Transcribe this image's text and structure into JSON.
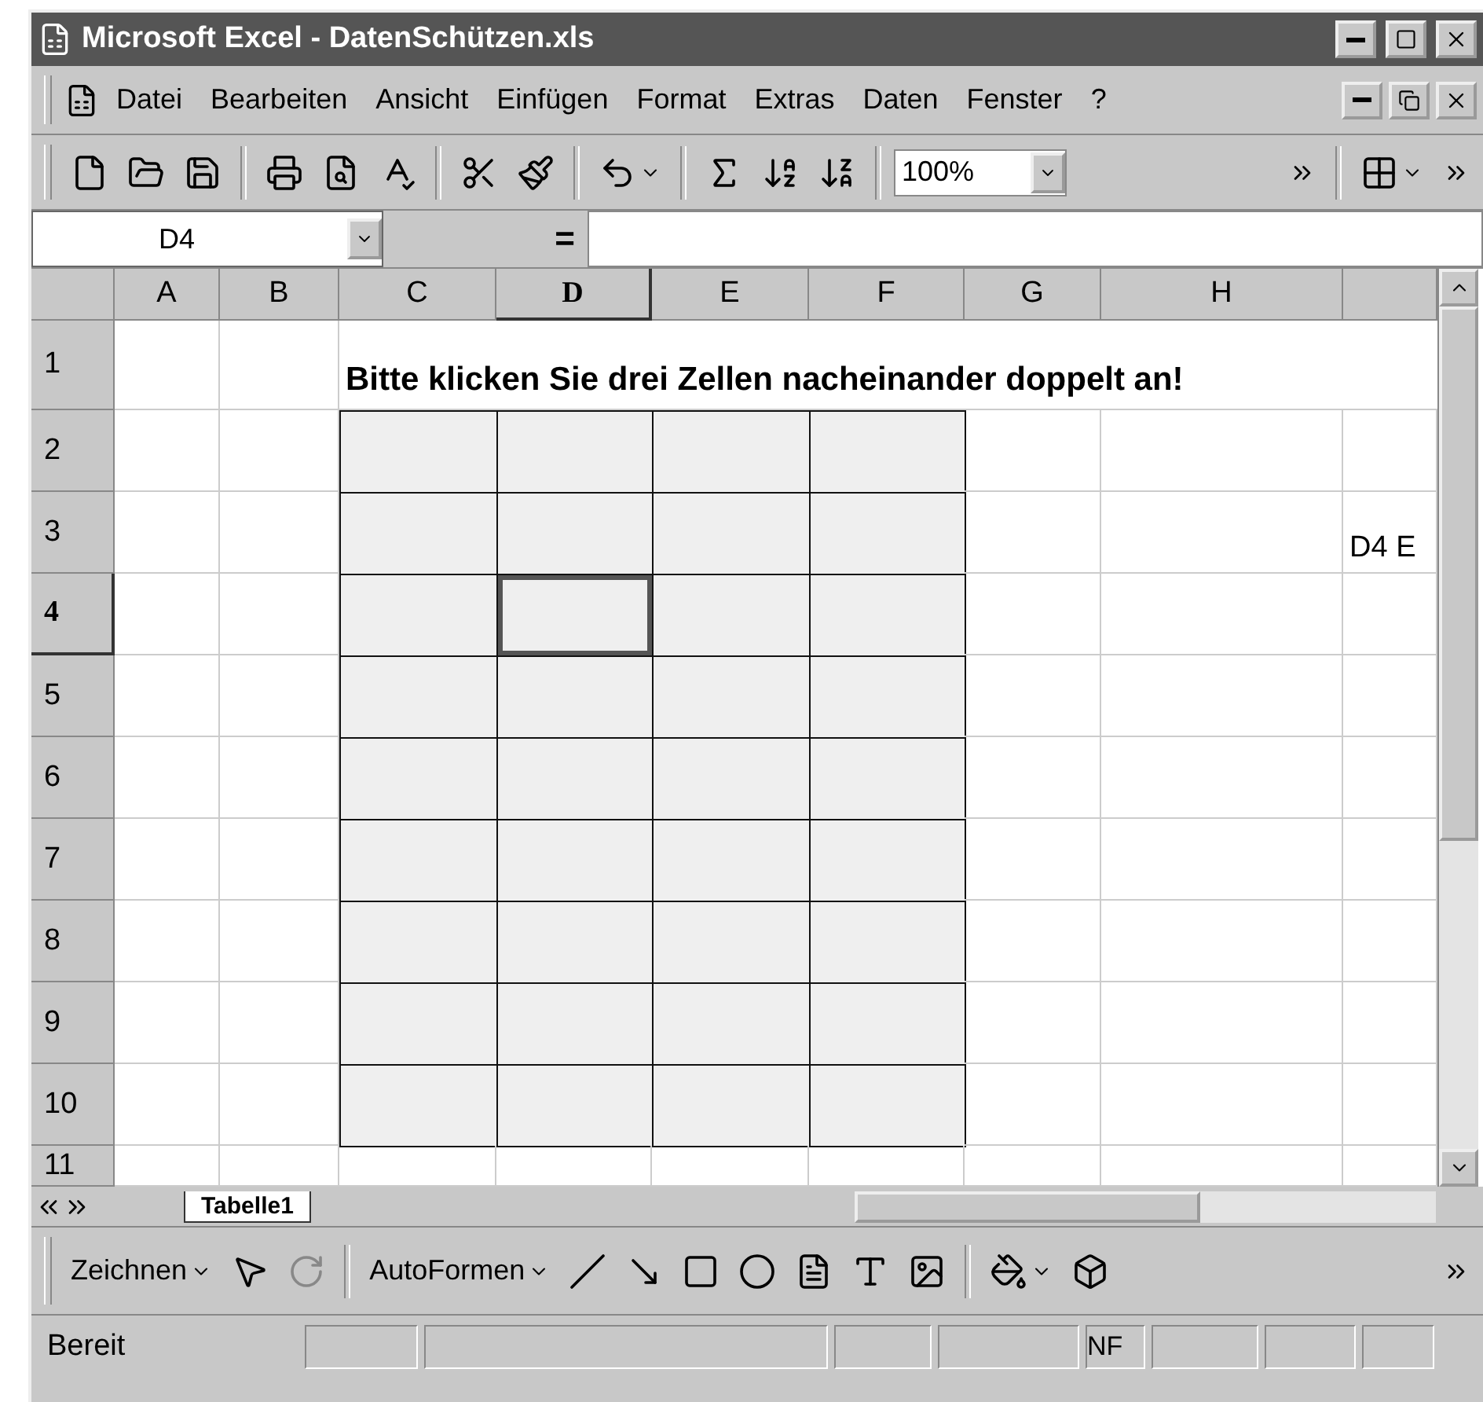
{
  "window": {
    "title": "Microsoft Excel - DatenSchützen.xls"
  },
  "menu_bar": {
    "items": [
      {
        "label": "Datei"
      },
      {
        "label": "Bearbeiten"
      },
      {
        "label": "Ansicht"
      },
      {
        "label": "Einfügen"
      },
      {
        "label": "Format"
      },
      {
        "label": "Extras"
      },
      {
        "label": "Daten"
      },
      {
        "label": "Fenster"
      },
      {
        "label": "?"
      }
    ]
  },
  "toolbar": {
    "zoom": "100%"
  },
  "name_box": {
    "value": "D4"
  },
  "formula_bar": {
    "label": "="
  },
  "sheet": {
    "columns": [
      {
        "label": "A",
        "selected": false
      },
      {
        "label": "B",
        "selected": false
      },
      {
        "label": "C",
        "selected": false
      },
      {
        "label": "D",
        "selected": true
      },
      {
        "label": "E",
        "selected": false
      },
      {
        "label": "F",
        "selected": false
      },
      {
        "label": "G",
        "selected": false
      },
      {
        "label": "H",
        "selected": false
      }
    ],
    "rows": [
      {
        "label": "1",
        "selected": false
      },
      {
        "label": "2",
        "selected": false
      },
      {
        "label": "3",
        "selected": false
      },
      {
        "label": "4",
        "selected": true
      },
      {
        "label": "5",
        "selected": false
      },
      {
        "label": "6",
        "selected": false
      },
      {
        "label": "7",
        "selected": false
      },
      {
        "label": "8",
        "selected": false
      },
      {
        "label": "9",
        "selected": false
      },
      {
        "label": "10",
        "selected": false
      },
      {
        "label": "11",
        "selected": false
      }
    ],
    "heading": "Bitte klicken Sie drei Zellen nacheinander doppelt an!",
    "overflow_text": "D4 E"
  },
  "sheet_tabs": [
    {
      "label": "Tabelle1",
      "selected": true
    }
  ],
  "drawing_toolbar": {
    "items": [
      {
        "label": "Zeichnen"
      },
      {
        "label": "AutoFormen"
      }
    ]
  },
  "status_bar": {
    "text": "Bereit",
    "indicator": "NF"
  }
}
